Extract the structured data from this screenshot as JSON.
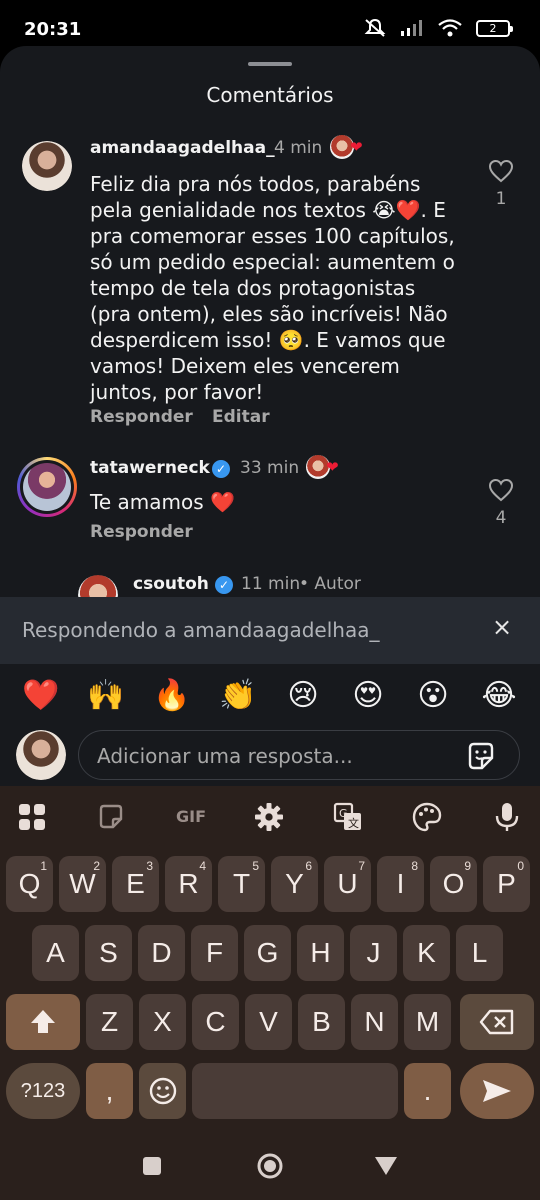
{
  "status": {
    "time": "20:31",
    "battery": "2"
  },
  "sheet": {
    "title": "Comentários"
  },
  "comments": [
    {
      "username": "amandaagadelhaa_",
      "time": "4 min",
      "lines": [
        "Feliz dia pra nós todos, parabéns",
        "pela genialidade nos textos 😭❤️. E",
        "pra comemorar esses 100 capítulos,",
        "só um pedido especial: aumentem o",
        "tempo de tela dos protagonistas",
        "(pra ontem), eles são incríveis! Não",
        "desperdicem isso! 🥺. E vamos que",
        "vamos! Deixem eles vencerem",
        "juntos, por favor!"
      ],
      "reply_label": "Responder",
      "edit_label": "Editar",
      "likes": "1"
    },
    {
      "username": "tatawerneck",
      "time": "33 min",
      "text": "Te amamos ❤️",
      "reply_label": "Responder",
      "likes": "4"
    },
    {
      "username": "csoutoh",
      "time": "11 min",
      "author_label": "• Autor"
    }
  ],
  "reply_bar": {
    "text": "Respondendo a amandaagadelhaa_"
  },
  "emojis": [
    "❤️",
    "🙌",
    "🔥",
    "👏",
    "😢",
    "😍",
    "😮",
    "😂"
  ],
  "input": {
    "placeholder": "Adicionar uma resposta..."
  },
  "keyboard": {
    "gif_label": "GIF",
    "row1": [
      "Q",
      "W",
      "E",
      "R",
      "T",
      "Y",
      "U",
      "I",
      "O",
      "P"
    ],
    "row1_nums": [
      "1",
      "2",
      "3",
      "4",
      "5",
      "6",
      "7",
      "8",
      "9",
      "0"
    ],
    "row2": [
      "A",
      "S",
      "D",
      "F",
      "G",
      "H",
      "J",
      "K",
      "L"
    ],
    "row3": [
      "Z",
      "X",
      "C",
      "V",
      "B",
      "N",
      "M"
    ],
    "symbols_label": "?123",
    "comma": ",",
    "period": "."
  }
}
